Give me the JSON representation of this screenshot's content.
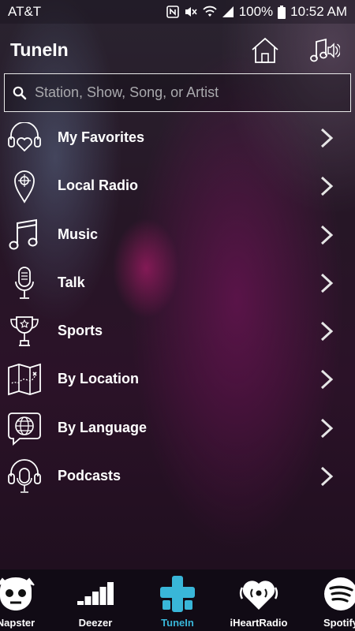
{
  "status_bar": {
    "carrier": "AT&T",
    "battery": "100%",
    "time": "10:52 AM",
    "icons": [
      "nfc-icon",
      "mute-icon",
      "wifi-icon",
      "signal-icon",
      "battery-icon"
    ]
  },
  "header": {
    "title": "TuneIn",
    "icons": [
      "home-icon",
      "music-speaker-icon"
    ]
  },
  "search": {
    "placeholder": "Station, Show, Song, or Artist",
    "value": ""
  },
  "menu": [
    {
      "label": "My Favorites",
      "icon": "heart-headphones-icon"
    },
    {
      "label": "Local Radio",
      "icon": "location-pin-icon"
    },
    {
      "label": "Music",
      "icon": "music-note-icon"
    },
    {
      "label": "Talk",
      "icon": "microphone-icon"
    },
    {
      "label": "Sports",
      "icon": "trophy-icon"
    },
    {
      "label": "By Location",
      "icon": "map-icon"
    },
    {
      "label": "By Language",
      "icon": "globe-speech-icon"
    },
    {
      "label": "Podcasts",
      "icon": "podcast-headphones-icon"
    }
  ],
  "tabs": [
    {
      "label": "Napster",
      "icon": "napster-icon",
      "active": false
    },
    {
      "label": "Deezer",
      "icon": "deezer-icon",
      "active": false
    },
    {
      "label": "TuneIn",
      "icon": "tunein-icon",
      "active": true
    },
    {
      "label": "iHeartRadio",
      "icon": "iheartradio-icon",
      "active": false
    },
    {
      "label": "Spotify",
      "icon": "spotify-icon",
      "active": false
    }
  ],
  "colors": {
    "active_tab": "#39b6d8",
    "text": "#ffffff"
  }
}
